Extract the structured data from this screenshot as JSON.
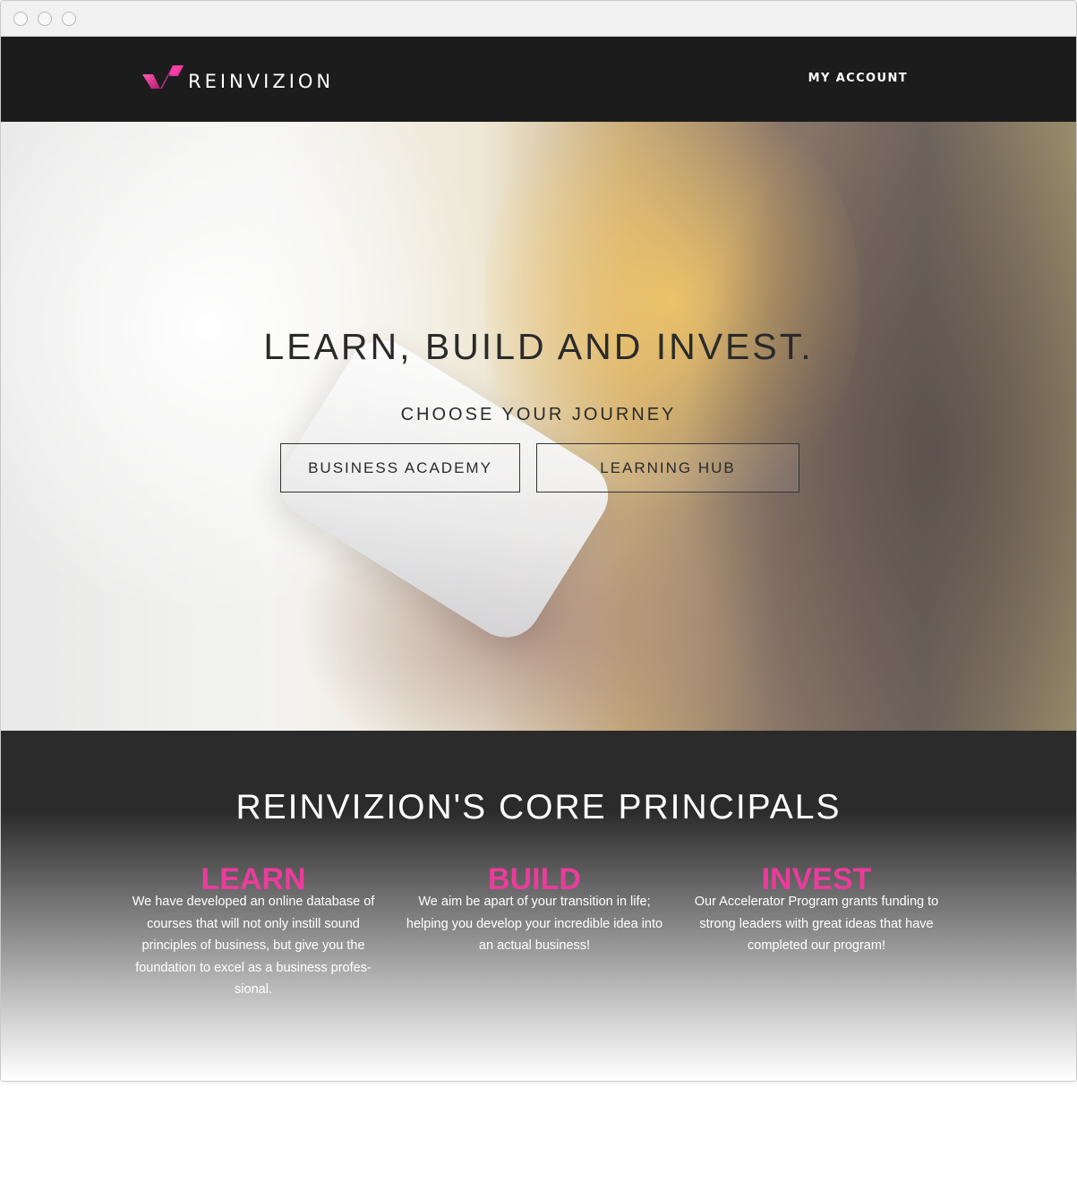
{
  "brand": {
    "name": "REINVIZION",
    "logo_icon": "reinvizion-v-logo",
    "accent_color": "#ea3c9b"
  },
  "nav": {
    "account_label": "MY ACCOUNT"
  },
  "hero": {
    "title": "LEARN, BUILD AND INVEST.",
    "subtitle": "CHOOSE YOUR JOURNEY",
    "buttons": [
      {
        "label": "BUSINESS ACADEMY"
      },
      {
        "label": "LEARNING HUB"
      }
    ]
  },
  "principals": {
    "title": "REINVIZION'S CORE PRINCIPALS",
    "items": [
      {
        "heading": "LEARN",
        "text": "We have developed an online database of courses that will not only instill sound principles of business, but give you the foundation to excel as a business profes-sional."
      },
      {
        "heading": "BUILD",
        "text": "We aim be apart of your transition in life; helping you develop your incredible idea into an actual business!"
      },
      {
        "heading": "INVEST",
        "text": "Our Accelerator Program grants funding to strong leaders with great ideas that have completed our program!"
      }
    ]
  }
}
